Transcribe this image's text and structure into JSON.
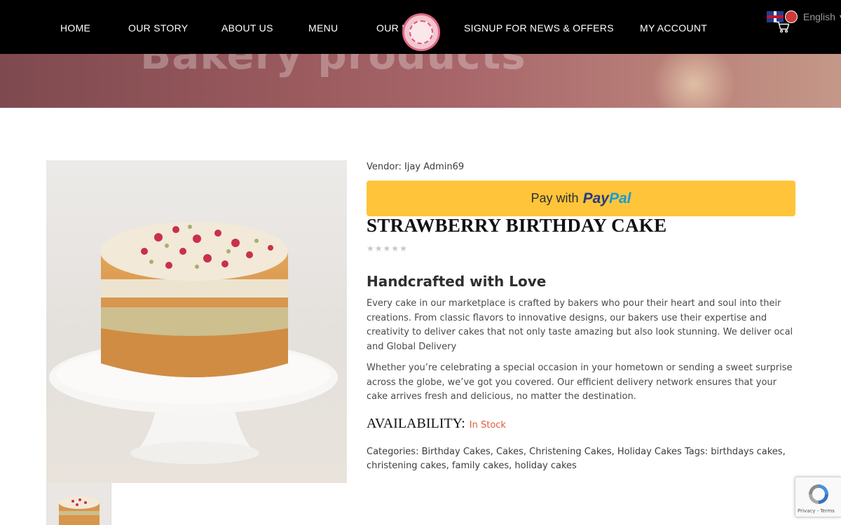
{
  "hero": {
    "title": "Bakery products"
  },
  "nav": {
    "items": [
      {
        "label": "HOME"
      },
      {
        "label": "OUR STORY"
      },
      {
        "label": "ABOUT US"
      },
      {
        "label": "MENU"
      },
      {
        "label": "OUR B"
      },
      {
        "label": "SIGNUP FOR NEWS & OFFERS"
      },
      {
        "label": "MY ACCOUNT"
      }
    ],
    "language": {
      "label": "English",
      "flag_icon": "uk-flag-icon"
    },
    "cart_icon": "shopping-cart-icon",
    "logo_icon": "bakery-logo-icon"
  },
  "product": {
    "vendor": "Vendor: Ijay Admin69",
    "paypal": {
      "prefix": "Pay with",
      "brand_a": "Pay",
      "brand_b": "Pal"
    },
    "title": "STRAWBERRY BIRTHDAY CAKE",
    "rating": 0,
    "subheading": "Handcrafted with Love",
    "paragraph1": "Every cake in our marketplace is crafted by bakers who pour their heart and soul into their creations. From classic flavors to innovative designs, our bakers use their expertise and creativity to deliver cakes that not only taste amazing but also look stunning. We deliver ocal and Global Delivery",
    "paragraph2": "Whether you’re celebrating a special occasion in your hometown or sending a sweet surprise across the globe, we’ve got you covered. Our efficient delivery network ensures that your cake arrives fresh and delicious, no matter the destination.",
    "availability_label": "AVAILABILITY:",
    "availability_value": "In Stock",
    "categories_label": "Categories:",
    "categories": [
      "Birthday Cakes",
      "Cakes",
      "Christening Cakes",
      "Holiday Cakes"
    ],
    "tags_label": "Tags:",
    "tags": [
      "birthdays cakes",
      "christening cakes",
      "family cakes",
      "holiday cakes"
    ]
  },
  "recaptcha": {
    "footer": "Privacy - Terms"
  },
  "colors": {
    "accent": "#e05a3c",
    "paypal_yellow": "#ffc439",
    "nav_bg": "#000000"
  }
}
